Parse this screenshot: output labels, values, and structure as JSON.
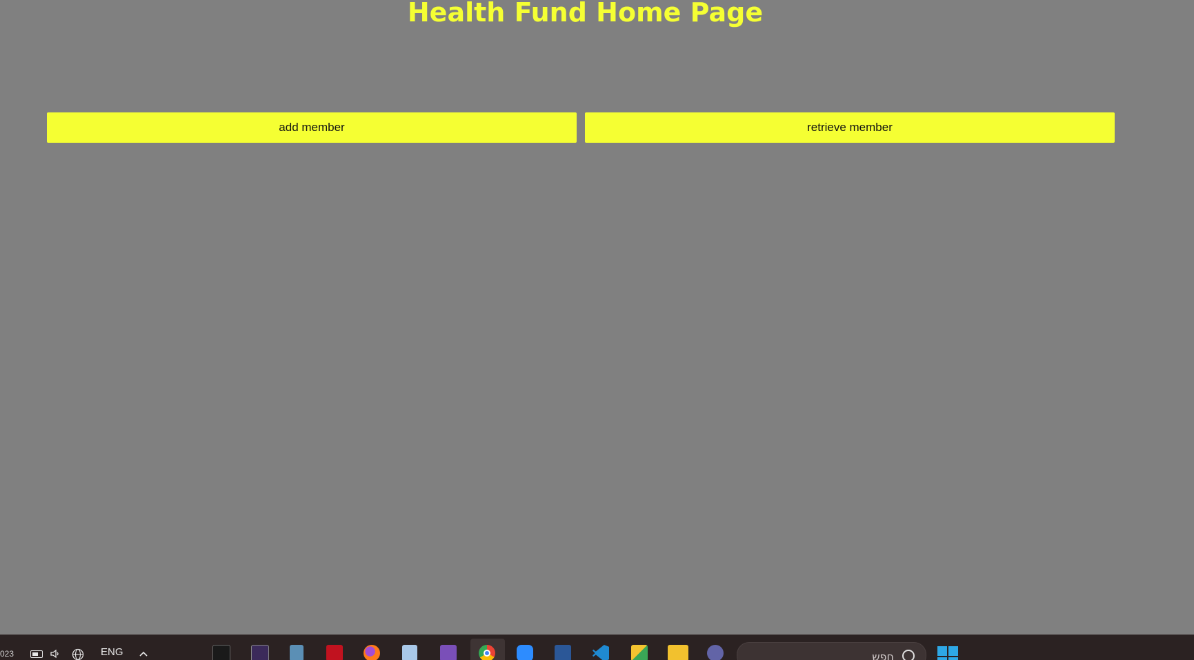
{
  "page": {
    "title": "Health Fund Home Page"
  },
  "actions": {
    "add_label": "add member",
    "retrieve_label": "retrieve member"
  },
  "taskbar": {
    "clock_fragment": "023",
    "language": "ENG",
    "search_placeholder": "חפש",
    "icons": [
      "terminal-icon",
      "command-prompt-icon",
      "calculator-icon",
      "acrobat-icon",
      "firefox-icon",
      "package-icon",
      "visual-studio-icon",
      "chrome-icon",
      "zoom-icon",
      "word-icon",
      "vscode-icon",
      "photos-icon",
      "file-explorer-icon",
      "teams-icon"
    ]
  },
  "colors": {
    "background": "#808080",
    "accent_yellow": "#f5ff33",
    "taskbar": "#2b2222"
  }
}
